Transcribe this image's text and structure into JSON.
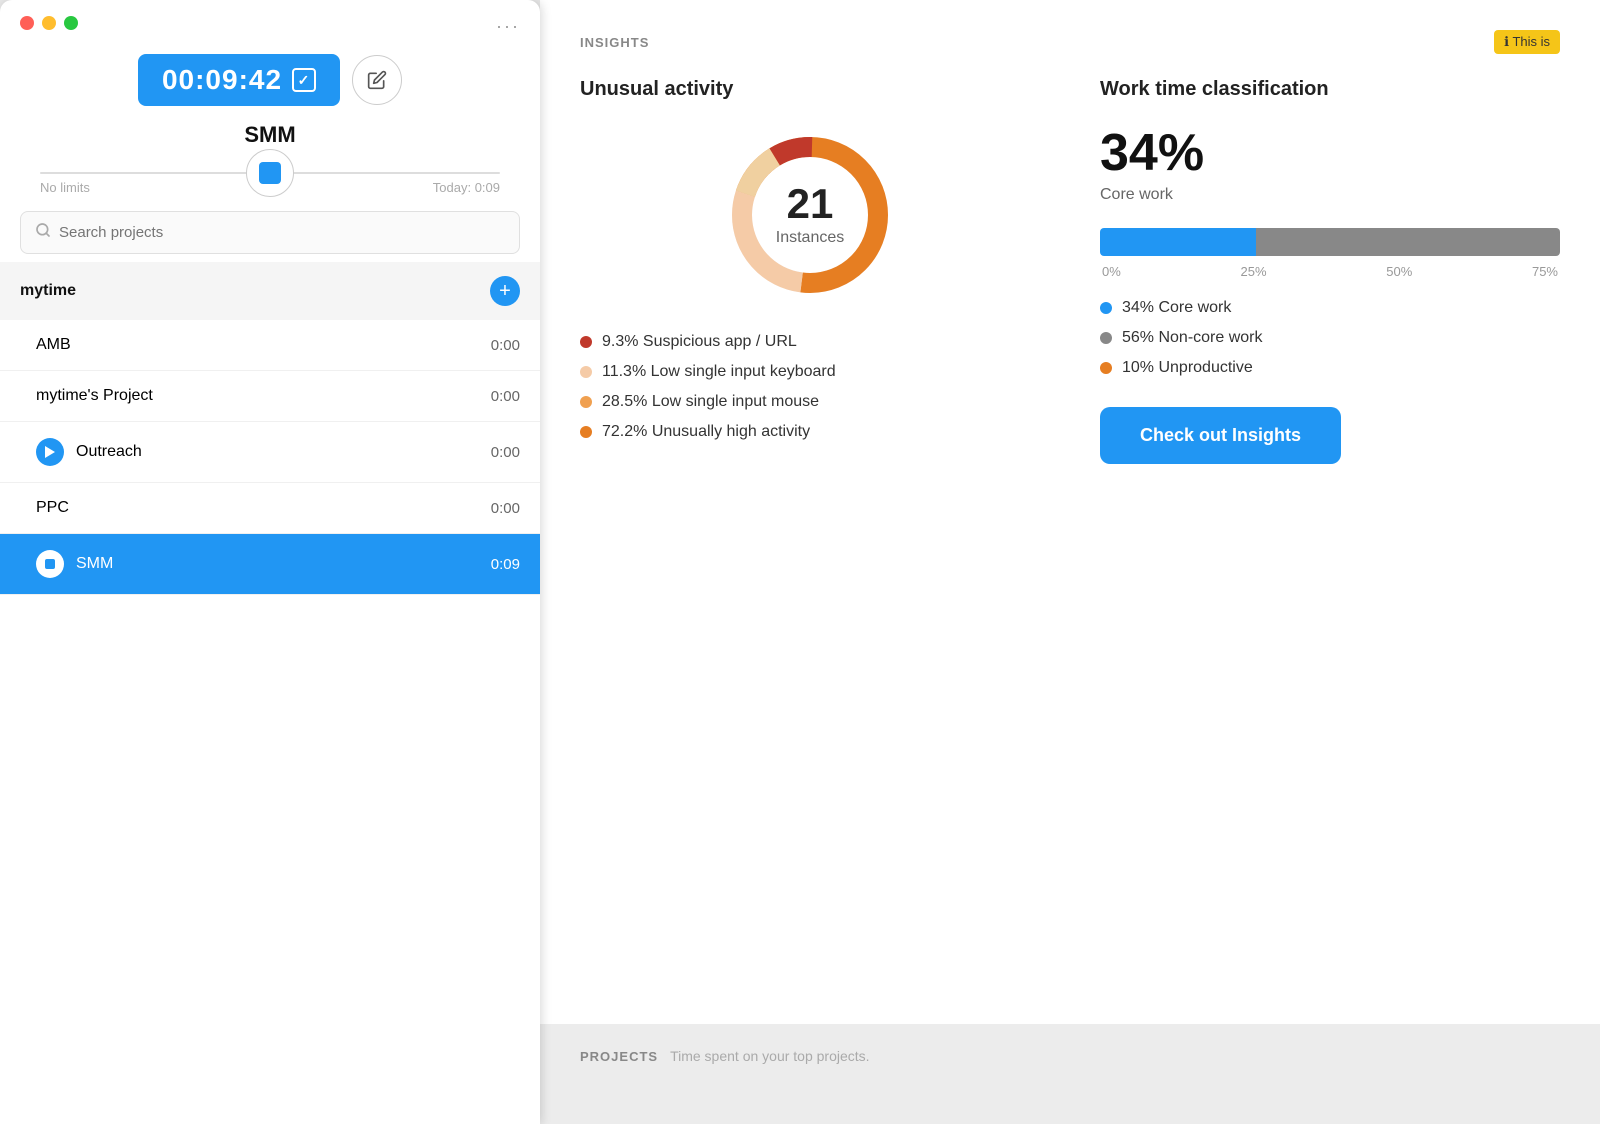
{
  "left": {
    "timer": {
      "display": "00:09:42",
      "dots_label": "···"
    },
    "project_name": "SMM",
    "slider": {
      "left_label": "No limits",
      "right_label": "Today: 0:09"
    },
    "search": {
      "placeholder": "Search projects"
    },
    "group": {
      "name": "mytime",
      "add_label": "+"
    },
    "projects": [
      {
        "name": "AMB",
        "time": "0:00",
        "active": false,
        "playing": false
      },
      {
        "name": "mytime's Project",
        "time": "0:00",
        "active": false,
        "playing": false
      },
      {
        "name": "Outreach",
        "time": "0:00",
        "active": false,
        "playing": true
      },
      {
        "name": "PPC",
        "time": "0:00",
        "active": false,
        "playing": false
      },
      {
        "name": "SMM",
        "time": "0:09",
        "active": true,
        "playing": false
      }
    ]
  },
  "right": {
    "insights_label": "INSIGHTS",
    "info_badge": "ℹ This is",
    "unusual_activity": {
      "title": "Unusual activity",
      "donut": {
        "number": "21",
        "label": "Instances"
      },
      "legend": [
        {
          "color": "#c0392b",
          "text": "9.3% Suspicious app / URL"
        },
        {
          "color": "#f5cba7",
          "text": "11.3% Low single input keyboard"
        },
        {
          "color": "#f0a050",
          "text": "28.5% Low single input mouse"
        },
        {
          "color": "#e67e22",
          "text": "72.2% Unusually high activity"
        }
      ]
    },
    "work_classification": {
      "title": "Work time classification",
      "percent": "34%",
      "core_label": "Core work",
      "blue_width": "34",
      "ticks": [
        "0%",
        "25%",
        "50%",
        "75%"
      ],
      "legend": [
        {
          "color": "#2196F3",
          "text": "34% Core work"
        },
        {
          "color": "#888888",
          "text": "56% Non-core work"
        },
        {
          "color": "#e67e22",
          "text": "10% Unproductive"
        }
      ]
    },
    "check_out_btn": "Check out Insights",
    "projects_label": "PROJECTS",
    "projects_subtitle": "Time spent on your top projects."
  }
}
